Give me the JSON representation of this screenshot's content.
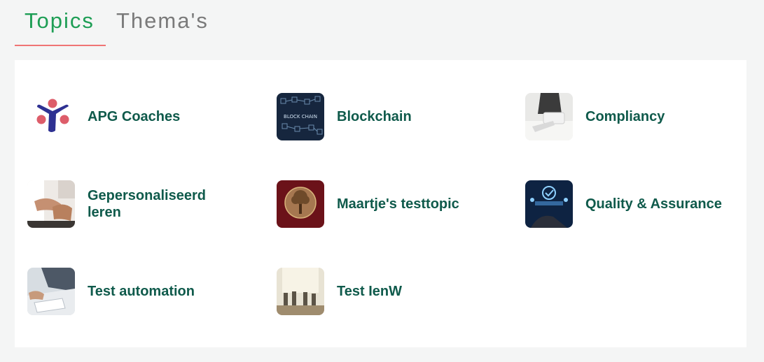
{
  "tabs": [
    {
      "label": "Topics",
      "active": true
    },
    {
      "label": "Thema's",
      "active": false
    }
  ],
  "colors": {
    "active_tab": "#1e9e55",
    "inactive_tab": "#7a7a7a",
    "tab_underline": "#ef7474",
    "topic_title": "#0f5a4b",
    "background": "#f4f5f5"
  },
  "topics": [
    {
      "title": "APG Coaches",
      "icon": "apg-logo-icon"
    },
    {
      "title": "Blockchain",
      "icon": "blockchain-image"
    },
    {
      "title": "Compliancy",
      "icon": "compliancy-image"
    },
    {
      "title": "Gepersonaliseerd leren",
      "icon": "personalised-learning-image"
    },
    {
      "title": "Maartje's testtopic",
      "icon": "tree-emblem-image"
    },
    {
      "title": "Quality & Assurance",
      "icon": "quality-assurance-image"
    },
    {
      "title": "Test automation",
      "icon": "test-automation-image"
    },
    {
      "title": "Test IenW",
      "icon": "meeting-room-image"
    }
  ]
}
